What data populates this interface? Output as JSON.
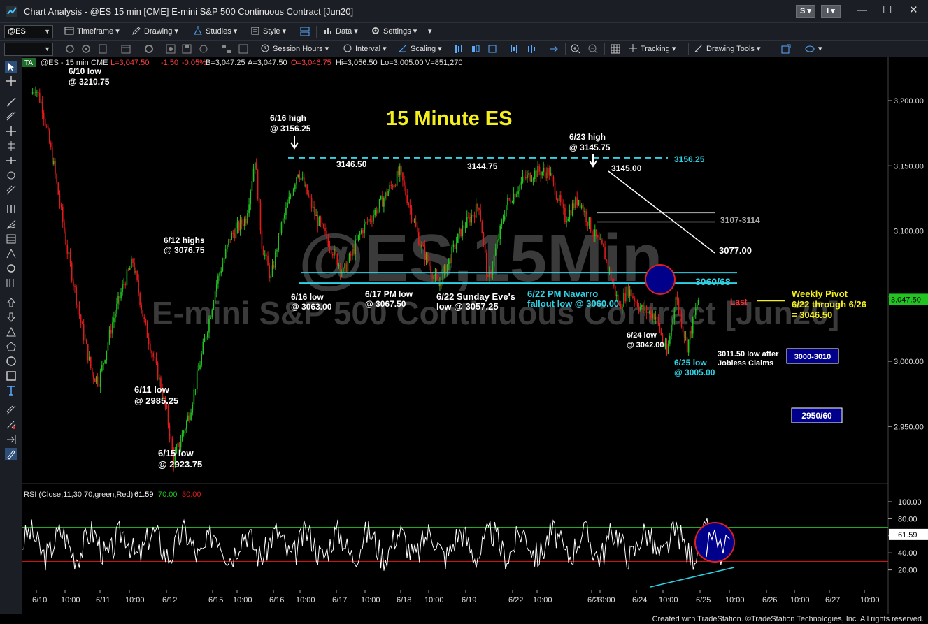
{
  "window": {
    "title": "Chart Analysis - @ES 15 min [CME] E-mini S&P 500 Continuous Contract [Jun20]",
    "btn_s": "S",
    "btn_i": "I"
  },
  "toolbar1": {
    "symbol": "@ES",
    "timeframe": "Timeframe",
    "drawing": "Drawing",
    "studies": "Studies",
    "style": "Style",
    "data": "Data",
    "settings": "Settings"
  },
  "toolbar2": {
    "session_hours": "Session Hours",
    "interval": "Interval",
    "scaling": "Scaling",
    "tracking": "Tracking",
    "drawing_tools": "Drawing Tools"
  },
  "chart_header": {
    "ta": "TA",
    "symbol": "@ES - 15 min",
    "exchange": "CME",
    "last": "L=3,047.50",
    "net": "-1.50",
    "pct": "-0.05%",
    "bid": "B=3,047.25",
    "ask": "A=3,047.50",
    "open": "O=3,046.75",
    "high": "Hi=3,056.50",
    "low": "Lo=3,005.00",
    "volume": "V=851,270"
  },
  "watermark": {
    "line1": "@ES,15Min",
    "line2": "E-mini S&P 500 Continuous Contract [Jun20]"
  },
  "chart_data": {
    "type": "candlestick",
    "title": "15 Minute ES",
    "price_axis": {
      "ticks": [
        "3,200.00",
        "3,150.00",
        "3,100.00",
        "3,050.00",
        "3,000.00",
        "2,950.00"
      ],
      "tick_values": [
        3200,
        3150,
        3100,
        3050,
        3000,
        2950
      ],
      "last_value": "3,047.50"
    },
    "rsi_axis": {
      "ticks": [
        "100.00",
        "80.00",
        "60.00",
        "40.00",
        "20.00"
      ],
      "tick_values": [
        100,
        80,
        60,
        40,
        20
      ],
      "last_value": "61.59"
    },
    "time_axis": [
      "6/10",
      "10:00",
      "6/11",
      "10:00",
      "6/12",
      "6/15",
      "10:00",
      "6/16",
      "10:00",
      "6/17",
      "10:00",
      "6/18",
      "10:00",
      "6/19",
      "6/22",
      "10:00",
      "6/23",
      "10:00",
      "6/24",
      "10:00",
      "6/25",
      "10:00",
      "6/26",
      "10:00",
      "6/27",
      "10:00"
    ],
    "price_path": [
      [
        6.1,
        3205
      ],
      [
        6.2,
        3210.75
      ],
      [
        6.35,
        3195
      ],
      [
        6.6,
        3150
      ],
      [
        6.9,
        3085
      ],
      [
        7.2,
        3030
      ],
      [
        7.45,
        2990
      ],
      [
        7.6,
        2985.25
      ],
      [
        7.9,
        3030
      ],
      [
        8.15,
        3060
      ],
      [
        8.35,
        3076.75
      ],
      [
        8.6,
        3030
      ],
      [
        8.9,
        2990
      ],
      [
        9.1,
        2960
      ],
      [
        9.25,
        2923.75
      ],
      [
        9.6,
        2960
      ],
      [
        9.9,
        3010
      ],
      [
        10.2,
        3060
      ],
      [
        10.5,
        3095
      ],
      [
        10.85,
        3110
      ],
      [
        11.05,
        3156.25
      ],
      [
        11.2,
        3090
      ],
      [
        11.4,
        3063
      ],
      [
        11.6,
        3100
      ],
      [
        12.0,
        3146.5
      ],
      [
        12.4,
        3110
      ],
      [
        12.7,
        3090
      ],
      [
        13.0,
        3067.5
      ],
      [
        13.4,
        3100
      ],
      [
        13.8,
        3120
      ],
      [
        14.25,
        3144.75
      ],
      [
        14.7,
        3090
      ],
      [
        15.1,
        3057.25
      ],
      [
        15.6,
        3100
      ],
      [
        16.0,
        3120
      ],
      [
        16.2,
        3060
      ],
      [
        16.6,
        3120
      ],
      [
        17.0,
        3140
      ],
      [
        17.3,
        3145.75
      ],
      [
        17.55,
        3145
      ],
      [
        17.9,
        3110
      ],
      [
        18.2,
        3125
      ],
      [
        18.5,
        3100
      ],
      [
        18.75,
        3085
      ],
      [
        18.95,
        3060
      ],
      [
        19.1,
        3042
      ],
      [
        19.3,
        3055
      ],
      [
        19.6,
        3040
      ],
      [
        19.9,
        3035
      ],
      [
        20.15,
        3005
      ],
      [
        20.35,
        3050
      ],
      [
        20.6,
        3011.5
      ],
      [
        20.85,
        3047.5
      ]
    ],
    "rsi_band": [
      30,
      70
    ],
    "horizontal_levels": [
      {
        "label": "3156.25",
        "value": 3156.25,
        "style": "dashed",
        "color": "#2fd3e6"
      },
      {
        "label": "3107-3114",
        "value": 3114,
        "value2": 3107,
        "color": "#9a9a9a"
      },
      {
        "label": "3060/68",
        "value": 3068,
        "value2": 3060,
        "color": "#2fd3e6"
      },
      {
        "label": "Last",
        "value": 3047.5,
        "color": "#ff3030"
      }
    ],
    "labels": {
      "a_610": "6/10 low",
      "a_610b": "@ 3210.75",
      "a_616h": "6/16 high",
      "a_616hb": "@ 3156.25",
      "a_3146": "3146.50",
      "a_3144": "3144.75",
      "a_623h": "6/23 high",
      "a_623hb": "@ 3145.75",
      "a_3145": "3145.00",
      "a_3156": "3156.25",
      "a_3107": "3107-3114",
      "a_3077": "3077.00",
      "a_612": "6/12 highs",
      "a_612b": "@ 3076.75",
      "a_616l": "6/16 low",
      "a_616lb": "@ 3063.00",
      "a_617": "6/17 PM low",
      "a_617b": "@ 3067.50",
      "a_622s": "6/22 Sunday Eve's",
      "a_622sb": "low @ 3057.25",
      "a_622n": "6/22 PM Navarro",
      "a_622nb": "fallout low @ 3060.00",
      "a_3060": "3060/68",
      "a_last": "Last",
      "a_wp1": "Weekly Pivot",
      "a_wp2": "6/22 through 6/26",
      "a_wp3": "= 3046.50",
      "a_624": "6/24 low",
      "a_624b": "@ 3042.00",
      "a_3011": "3011.50 low after",
      "a_3011b": "Jobless Claims",
      "a_625": "6/25 low",
      "a_625b": "@ 3005.00",
      "a_611": "6/11 low",
      "a_611b": "@ 2985.25",
      "a_615": "6/15 low",
      "a_615b": "@ 2923.75",
      "box_3000": "3000-3010",
      "box_2950": "2950/60"
    },
    "rsi_title": "RSI (Close,11,30,70,green,Red)",
    "rsi_v1": "61.59",
    "rsi_v2": "70.00",
    "rsi_v3": "30.00"
  },
  "footer": {
    "credit": "Created with TradeStation. ©TradeStation Technologies, Inc. All rights reserved."
  },
  "colors": {
    "up": "#22c422",
    "down": "#e01b1b",
    "cyan": "#2fd3e6",
    "yellow": "#f4ee1a",
    "navy": "#00008b"
  }
}
